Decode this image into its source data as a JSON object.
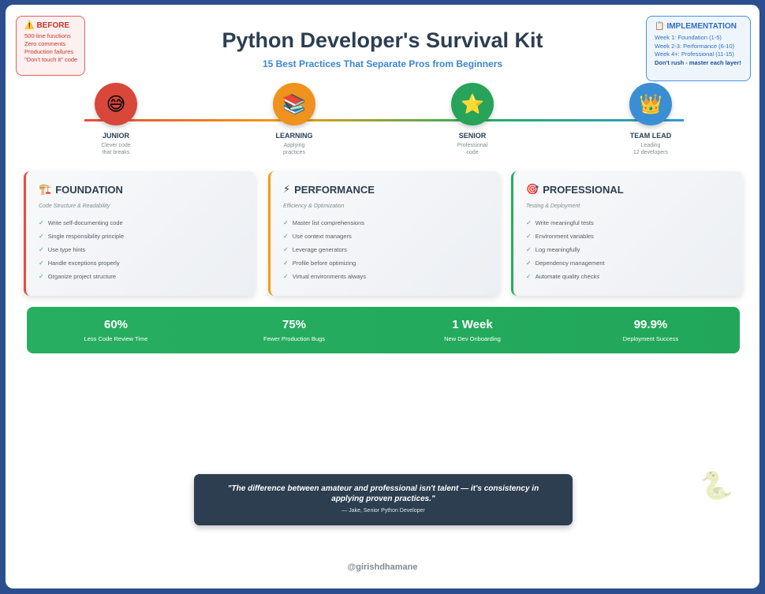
{
  "header": {
    "title": "Python Developer's Survival Kit",
    "subtitle": "15 Best Practices That Separate Pros from Beginners"
  },
  "before": {
    "icon": "⚠️",
    "title": "BEFORE",
    "items": [
      "500-line functions",
      "Zero comments",
      "Production failures",
      "\"Don't touch it\" code"
    ]
  },
  "implementation": {
    "icon": "📋",
    "title": "IMPLEMENTATION",
    "items": [
      "Week 1: Foundation (1-5)",
      "Week 2-3: Performance (6-10)",
      "Week 4+: Professional (11-15)"
    ],
    "note": "Don't rush - master each layer!"
  },
  "timeline": [
    {
      "icon": "😅",
      "name": "JUNIOR",
      "desc": "Clever code\nthat breaks",
      "color": "#d9473a"
    },
    {
      "icon": "📚",
      "name": "LEARNING",
      "desc": "Applying\npractices",
      "color": "#f0921e"
    },
    {
      "icon": "⭐",
      "name": "SENIOR",
      "desc": "Professional\ncode",
      "color": "#27a35a"
    },
    {
      "icon": "👑",
      "name": "TEAM LEAD",
      "desc": "Leading\n12 developers",
      "color": "#3a8fd4"
    }
  ],
  "cards": [
    {
      "icon": "🏗️",
      "title": "FOUNDATION",
      "subtitle": "Code Structure & Readability",
      "accent": "#e74c3c",
      "items": [
        "Write self-documenting code",
        "Single responsibility principle",
        "Use type hints",
        "Handle exceptions properly",
        "Organize project structure"
      ]
    },
    {
      "icon": "⚡",
      "title": "PERFORMANCE",
      "subtitle": "Efficiency & Optimization",
      "accent": "#f39c12",
      "items": [
        "Master list comprehensions",
        "Use context managers",
        "Leverage generators",
        "Profile before optimizing",
        "Virtual environments always"
      ]
    },
    {
      "icon": "🎯",
      "title": "PROFESSIONAL",
      "subtitle": "Testing & Deployment",
      "accent": "#27ae60",
      "items": [
        "Write meaningful tests",
        "Environment variables",
        "Log meaningfully",
        "Dependency management",
        "Automate quality checks"
      ]
    }
  ],
  "check": "✓",
  "stats": [
    {
      "value": "60%",
      "label": "Less Code Review Time"
    },
    {
      "value": "75%",
      "label": "Fewer Production Bugs"
    },
    {
      "value": "1 Week",
      "label": "New Dev Onboarding"
    },
    {
      "value": "99.9%",
      "label": "Deployment Success"
    }
  ],
  "quote": {
    "text": "\"The difference between amateur and professional isn't talent — it's consistency in applying proven practices.\"",
    "author": "— Jake, Senior Python Developer"
  },
  "decor": {
    "snake_icon": "🐍"
  },
  "footer": {
    "handle": "@girishdhamane"
  }
}
